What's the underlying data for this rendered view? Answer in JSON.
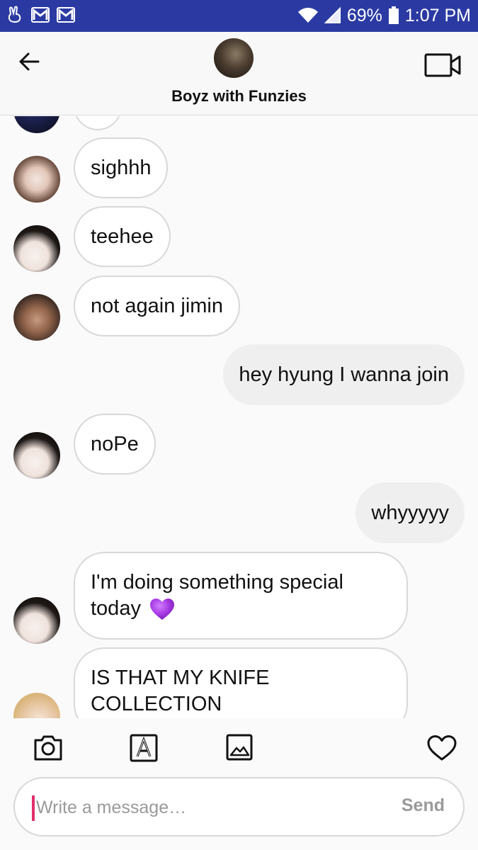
{
  "status_bar": {
    "battery": "69%",
    "time": "1:07 PM",
    "left_icons": [
      "peace-hand-icon",
      "gmail-icon",
      "gmail-icon"
    ],
    "right_icons": [
      "wifi-icon",
      "signal-icon",
      "battery-icon"
    ]
  },
  "header": {
    "title": "Boyz with Funzies",
    "back_icon": "arrow-left-icon",
    "video_icon": "video-camera-icon"
  },
  "messages": [
    {
      "side": "in",
      "text": ""
    },
    {
      "side": "in",
      "text": "sighhh"
    },
    {
      "side": "in",
      "text": "teehee"
    },
    {
      "side": "in",
      "text": "not again jimin"
    },
    {
      "side": "out",
      "text": "hey hyung I wanna join"
    },
    {
      "side": "in",
      "text": "noPe"
    },
    {
      "side": "out",
      "text": "whyyyyy"
    },
    {
      "side": "in",
      "line1": "I'm doing something special",
      "line2": "today",
      "emoji": "purple-heart-icon"
    },
    {
      "side": "in",
      "line1": "IS THAT MY KNIFE",
      "line2": "COLLECTION"
    }
  ],
  "toolbar": {
    "icons": [
      "camera-icon",
      "text-format-icon",
      "gallery-icon",
      "heart-icon"
    ]
  },
  "composer": {
    "placeholder": "Write a message…",
    "send_label": "Send"
  },
  "colors": {
    "status_bar": "#2b3aa3",
    "caret": "#e0306a",
    "heart_emoji": "#a236e0"
  }
}
